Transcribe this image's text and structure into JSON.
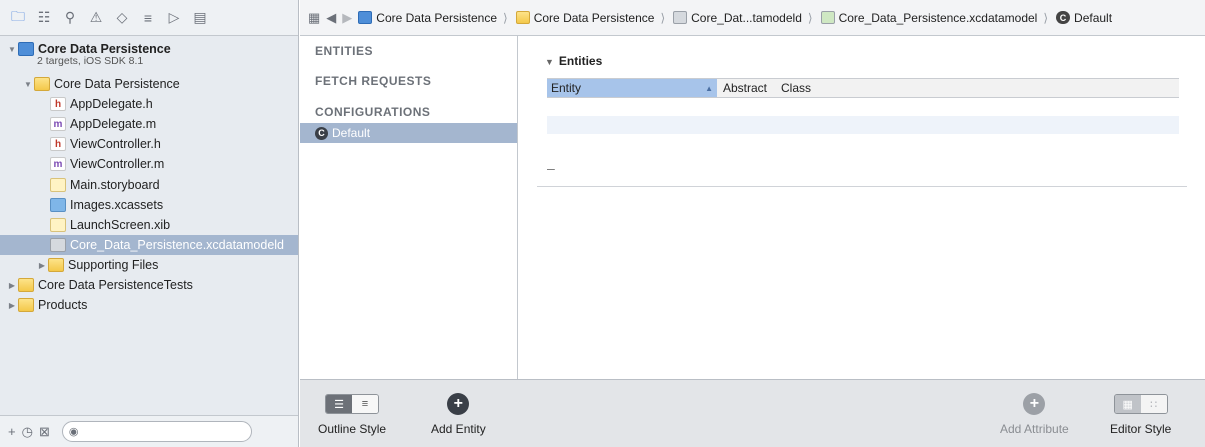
{
  "navigator": {
    "project": {
      "name": "Core Data Persistence",
      "subtitle": "2 targets, iOS SDK 8.1"
    },
    "items": [
      {
        "label": "Core Data Persistence",
        "icon": "folder-icon"
      },
      {
        "label": "AppDelegate.h",
        "icon": "header-file-icon",
        "glyph": "h"
      },
      {
        "label": "AppDelegate.m",
        "icon": "implementation-file-icon",
        "glyph": "m"
      },
      {
        "label": "ViewController.h",
        "icon": "header-file-icon",
        "glyph": "h"
      },
      {
        "label": "ViewController.m",
        "icon": "implementation-file-icon",
        "glyph": "m"
      },
      {
        "label": "Main.storyboard",
        "icon": "storyboard-icon"
      },
      {
        "label": "Images.xcassets",
        "icon": "asset-catalog-icon"
      },
      {
        "label": "LaunchScreen.xib",
        "icon": "xib-file-icon"
      },
      {
        "label": "Core_Data_Persistence.xcdatamodeld",
        "icon": "data-model-icon"
      },
      {
        "label": "Supporting Files",
        "icon": "folder-icon"
      },
      {
        "label": "Core Data PersistenceTests",
        "icon": "folder-icon"
      },
      {
        "label": "Products",
        "icon": "folder-icon"
      }
    ]
  },
  "jumpbar": {
    "crumbs": [
      "Core Data Persistence",
      "Core Data Persistence",
      "Core_Dat...tamodeld",
      "Core_Data_Persistence.xcdatamodel",
      "Default"
    ]
  },
  "outline": {
    "entities": "ENTITIES",
    "fetch_requests": "FETCH REQUESTS",
    "configurations": "CONFIGURATIONS",
    "default_config": "Default",
    "config_badge": "C"
  },
  "editor": {
    "section_title": "Entities",
    "columns": [
      "Entity",
      "Abstract",
      "Class"
    ],
    "remove_symbol": "–"
  },
  "bottombar": {
    "outline_style": "Outline Style",
    "add_entity": "Add Entity",
    "add_attribute": "Add Attribute",
    "editor_style": "Editor Style"
  },
  "colors": {
    "selection": "#a4b6cf",
    "header_sorted": "#a7c4ea",
    "sidebar_bg": "#e7ebf0"
  }
}
